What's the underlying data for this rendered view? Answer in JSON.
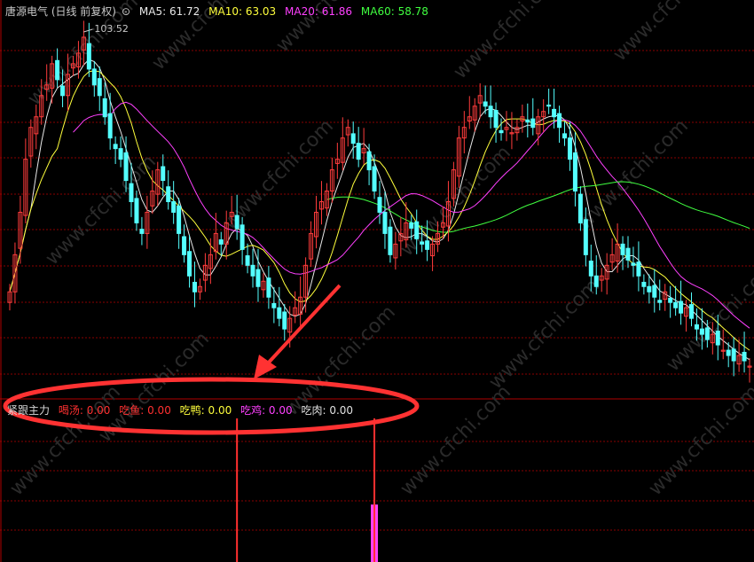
{
  "header": {
    "stock_title": "唐源电气 (日线 前复权)",
    "ma5_label": "MA5: 61.72",
    "ma10_label": "MA10: 63.03",
    "ma20_label": "MA20: 61.86",
    "ma60_label": "MA60: 58.78"
  },
  "indicator": {
    "name": "紧跟主力",
    "items": [
      {
        "label": "喝汤: 0.00",
        "color": "#ff3030"
      },
      {
        "label": "吃鱼: 0.00",
        "color": "#ff3030"
      },
      {
        "label": "吃鸭: 0.00",
        "color": "#ffff3c"
      },
      {
        "label": "吃鸡: 0.00",
        "color": "#ff40ff"
      },
      {
        "label": "吃肉: 0.00",
        "color": "#e0e0e0"
      }
    ]
  },
  "colors": {
    "up": "#ff3c3c",
    "down": "#54ffff",
    "ma5": "#e8e8e8",
    "ma10": "#ffff3c",
    "ma20": "#ff40ff",
    "ma60": "#40ff40",
    "grid": "#8a0000",
    "annotation": "#ff3232",
    "watermark": "#2a2a2a"
  },
  "watermark": "www.cfchi.com",
  "chart_data": [
    {
      "type": "candlestick",
      "title": "唐源电气 (日线 前复权)",
      "annotations": [
        {
          "type": "max_label",
          "text": "103.52",
          "value": 103.52
        }
      ],
      "series": [
        {
          "name": "MA5",
          "value": 61.72
        },
        {
          "name": "MA10",
          "value": 63.03
        },
        {
          "name": "MA20",
          "value": 61.86
        },
        {
          "name": "MA60",
          "value": 58.78
        }
      ],
      "ylim": [
        40,
        105
      ],
      "closes": [
        55,
        62,
        70,
        80,
        86,
        88,
        92,
        94,
        98,
        95,
        92,
        96,
        98,
        100,
        103,
        97,
        94,
        92,
        88,
        84,
        82,
        80,
        76,
        72,
        68,
        66,
        70,
        74,
        78,
        76,
        72,
        70,
        66,
        62,
        58,
        55,
        56,
        60,
        62,
        66,
        64,
        68,
        70,
        67,
        63,
        60,
        58,
        56,
        57,
        54,
        52,
        50,
        48,
        50,
        52,
        54,
        60,
        66,
        70,
        72,
        74,
        78,
        80,
        84,
        86,
        83,
        80,
        82,
        78,
        74,
        70,
        66,
        62,
        64,
        66,
        68,
        67,
        65,
        64,
        63,
        64,
        66,
        68,
        72,
        78,
        84,
        86,
        88,
        90,
        92,
        90,
        88,
        86,
        85,
        86,
        85,
        86,
        88,
        87,
        86,
        88,
        89,
        90,
        88,
        86,
        84,
        80,
        74,
        68,
        62,
        58,
        56,
        58,
        60,
        62,
        64,
        62,
        61,
        60,
        58,
        56,
        55,
        54,
        53,
        55,
        53,
        52,
        51,
        52,
        50,
        48,
        47,
        46,
        47,
        45,
        44,
        43,
        42,
        43,
        42,
        41
      ]
    },
    {
      "type": "bar",
      "title": "紧跟主力",
      "series": [
        {
          "name": "吃鱼",
          "color": "#ff3030",
          "values": [
            {
              "index": 43,
              "value": 1
            }
          ]
        },
        {
          "name": "吃鸡",
          "color": "#ff40ff",
          "values": [
            {
              "index": 69,
              "value": 0.4
            }
          ]
        },
        {
          "name": "吃肉",
          "color": "#ff3030",
          "values": [
            {
              "index": 69,
              "value": 1
            }
          ]
        }
      ]
    }
  ]
}
